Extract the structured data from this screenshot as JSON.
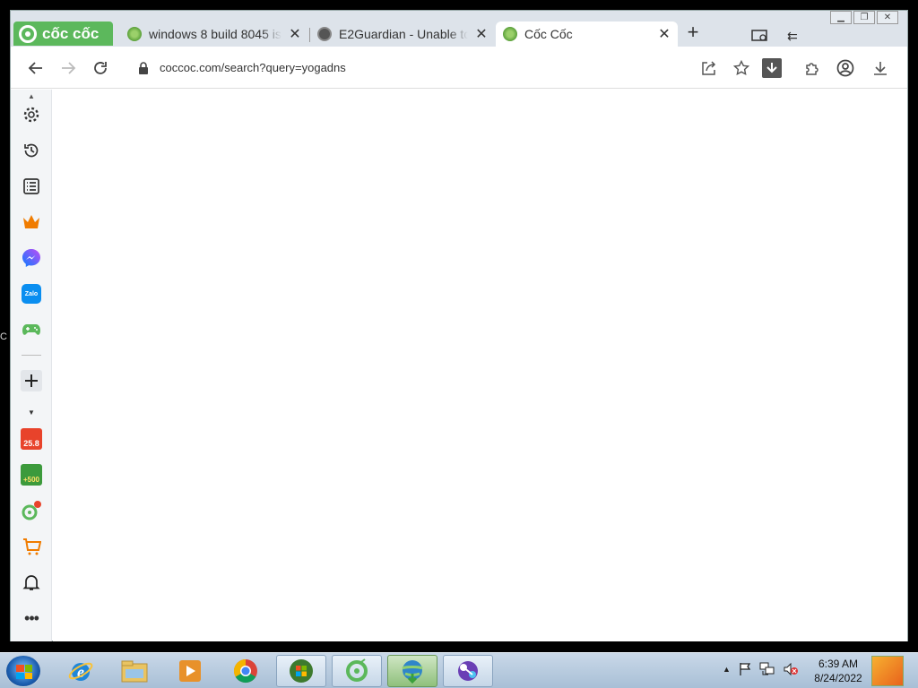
{
  "desktop": {
    "edge_label": "C"
  },
  "browser": {
    "tabs": [
      {
        "title": "windows 8 build 8045 is",
        "favicon": "coccoc-leaf-icon",
        "active": false
      },
      {
        "title": "E2Guardian - Unable to",
        "favicon": "globe-icon",
        "active": false
      },
      {
        "title": "Cốc Cốc",
        "favicon": "coccoc-leaf-icon",
        "active": true
      }
    ],
    "brand": "cốc cốc",
    "address": "coccoc.com/search?query=yogadns",
    "accent": "#5cb85c"
  },
  "sidebar": {
    "badge_sale": "25.8",
    "badge_coins": "+500",
    "zalo_label": "Zalo"
  },
  "taskbar": {
    "time": "6:39 AM",
    "date": "8/24/2022"
  }
}
